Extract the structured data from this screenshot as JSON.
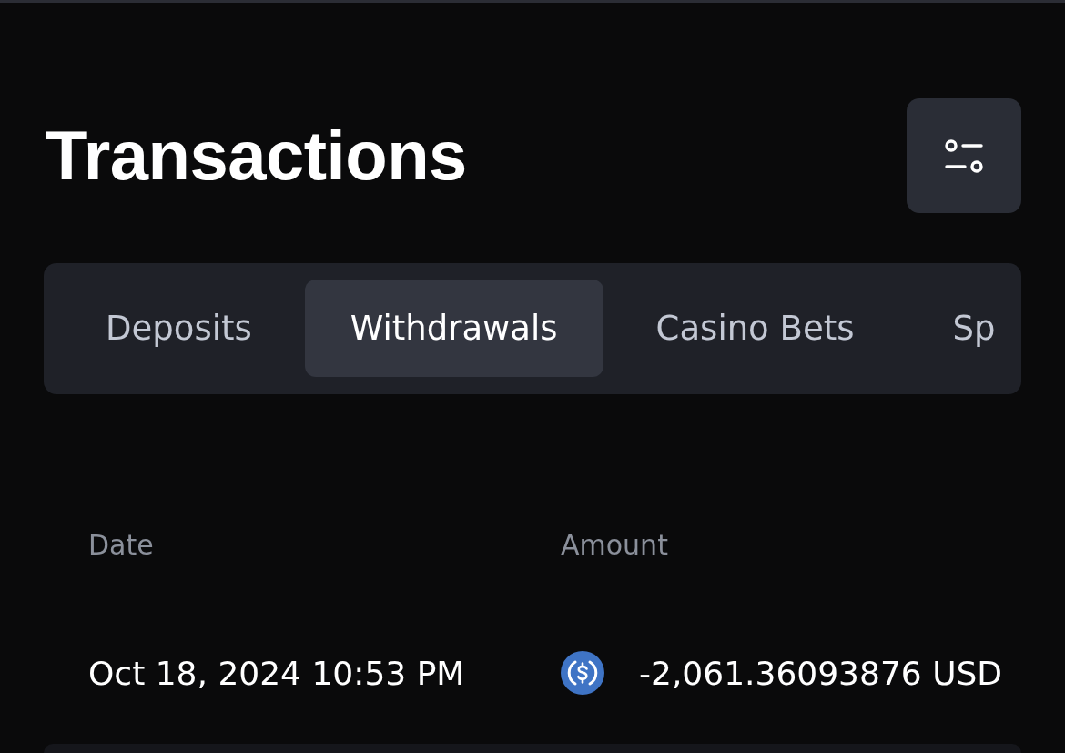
{
  "header": {
    "title": "Transactions"
  },
  "tabs": [
    {
      "label": "Deposits",
      "selected": false
    },
    {
      "label": "Withdrawals",
      "selected": true
    },
    {
      "label": "Casino Bets",
      "selected": false
    },
    {
      "label": "Sp",
      "selected": false
    }
  ],
  "table": {
    "columns": [
      "Date",
      "Amount"
    ],
    "rows": [
      {
        "date": "Oct 18, 2024 10:53 PM",
        "amount": "-2,061.36093876 USD"
      }
    ]
  }
}
